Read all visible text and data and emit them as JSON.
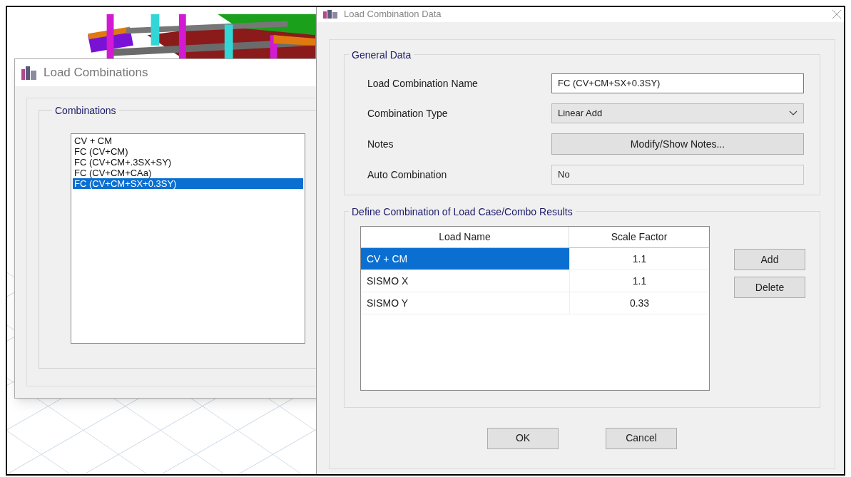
{
  "combinations_window": {
    "title": "Load Combinations",
    "group_label": "Combinations",
    "items": [
      {
        "label": "CV + CM",
        "selected": false
      },
      {
        "label": "FC (CV+CM)",
        "selected": false
      },
      {
        "label": "FC (CV+CM+.3SX+SY)",
        "selected": false
      },
      {
        "label": "FC (CV+CM+CAa)",
        "selected": false
      },
      {
        "label": "FC (CV+CM+SX+0.3SY)",
        "selected": true
      }
    ]
  },
  "data_window": {
    "title": "Load Combination Data",
    "general_data": {
      "label": "General Data",
      "name": {
        "label": "Load Combination Name",
        "value": "FC (CV+CM+SX+0.3SY)"
      },
      "type": {
        "label": "Combination Type",
        "value": "Linear Add"
      },
      "notes": {
        "label": "Notes",
        "button": "Modify/Show Notes..."
      },
      "auto": {
        "label": "Auto Combination",
        "value": "No"
      }
    },
    "define": {
      "label": "Define Combination of Load Case/Combo Results",
      "table": {
        "columns": [
          "Load Name",
          "Scale Factor"
        ],
        "rows": [
          {
            "load_name": "CV + CM",
            "scale_factor": "1.1",
            "selected": true
          },
          {
            "load_name": "SISMO X",
            "scale_factor": "1.1",
            "selected": false
          },
          {
            "load_name": "SISMO Y",
            "scale_factor": "0.33",
            "selected": false
          }
        ]
      },
      "buttons": [
        "Add",
        "Delete"
      ]
    },
    "buttons": [
      "OK",
      "Cancel"
    ]
  }
}
